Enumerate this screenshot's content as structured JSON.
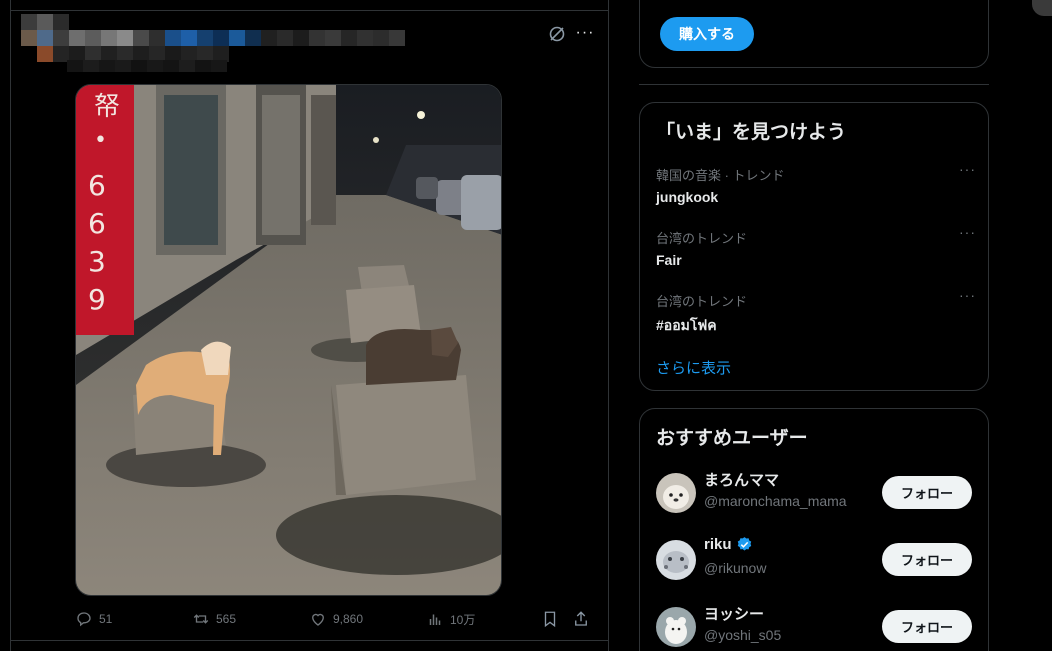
{
  "tweet": {
    "more_label": "···",
    "stats": {
      "replies": "51",
      "retweets": "565",
      "likes": "9,860",
      "views": "10万"
    },
    "photo_sign_text": "幣・6639"
  },
  "sidebar": {
    "premium": {
      "buy_label": "購入する"
    },
    "trends": {
      "title": "「いま」を見つけよう",
      "items": [
        {
          "meta": "韓国の音楽 · トレンド",
          "name": "jungkook"
        },
        {
          "meta": "台湾のトレンド",
          "name": "Fair"
        },
        {
          "meta": "台湾のトレンド",
          "name": "#ออมโฟค"
        }
      ],
      "more_label": "···",
      "show_more": "さらに表示"
    },
    "who_to_follow": {
      "title": "おすすめユーザー",
      "users": [
        {
          "name": "まろんママ",
          "handle": "@maronchama_mama",
          "verified": false,
          "follow": "フォロー"
        },
        {
          "name": "riku",
          "handle": "@rikunow",
          "verified": true,
          "follow": "フォロー"
        },
        {
          "name": "ヨッシー",
          "handle": "@yoshi_s05",
          "verified": false,
          "follow": "フォロー"
        }
      ]
    }
  },
  "colors": {
    "accent": "#1d9bf0",
    "muted": "#71767b",
    "border": "#2f3336",
    "background": "#000000"
  }
}
